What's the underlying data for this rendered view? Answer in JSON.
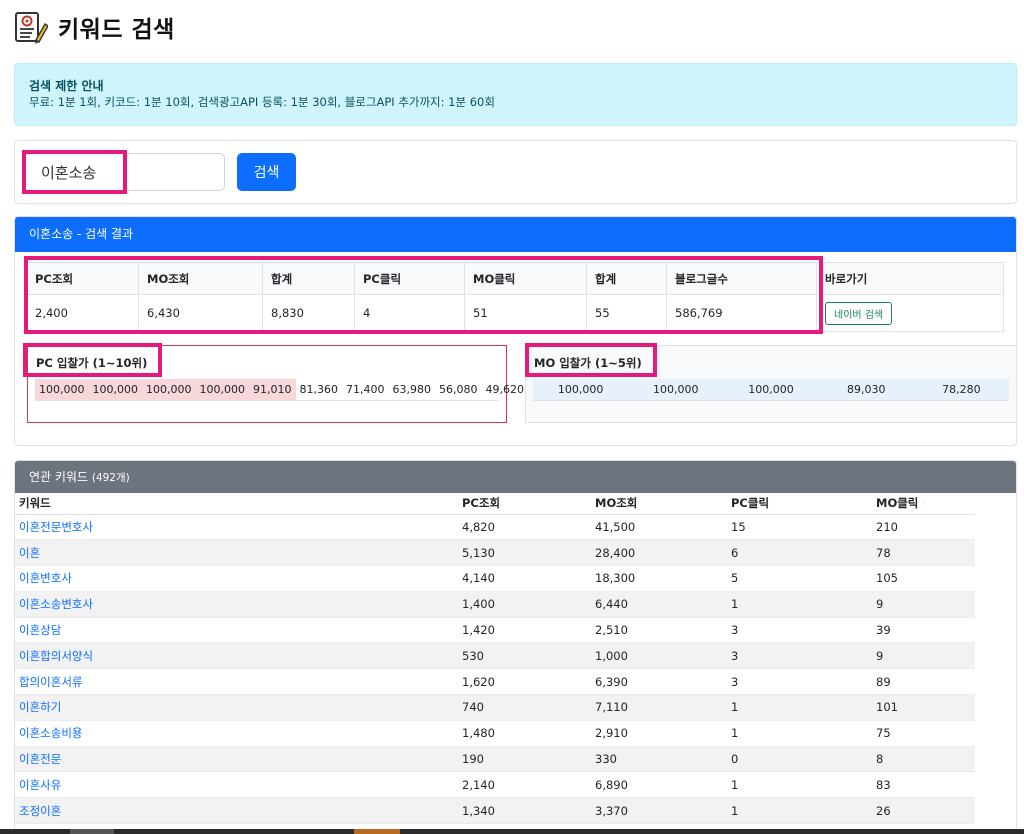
{
  "page": {
    "title": "키워드 검색",
    "icon": "memo-pencil-icon"
  },
  "notice": {
    "title": "검색 제한 안내",
    "text": "무료: 1분 1회, 키코드: 1분 10회, 검색광고API 등록: 1분 30회, 블로그API 추가까지: 1분 60회"
  },
  "search": {
    "value": "이혼소송",
    "button_label": "검색"
  },
  "result": {
    "header": "이혼소송 - 검색 결과",
    "columns": [
      "PC조회",
      "MO조회",
      "합계",
      "PC클릭",
      "MO클릭",
      "합계",
      "블로그글수",
      "바로가기"
    ],
    "values": [
      "2,400",
      "6,430",
      "8,830",
      "4",
      "51",
      "55",
      "586,769"
    ],
    "naver_button": "네이버 검색"
  },
  "pc_bid": {
    "title": "PC 입찰가 (1~10위)",
    "values": [
      "100,000",
      "100,000",
      "100,000",
      "100,000",
      "91,010",
      "81,360",
      "71,400",
      "63,980",
      "56,080",
      "49,620"
    ]
  },
  "mo_bid": {
    "title": "MO 입찰가 (1~5위)",
    "values": [
      "100,000",
      "100,000",
      "100,000",
      "89,030",
      "78,280"
    ]
  },
  "keywords": {
    "header": "연관 키워드",
    "count": "(492개)",
    "columns": [
      "키워드",
      "PC조회",
      "MO조회",
      "PC클릭",
      "MO클릭"
    ],
    "rows": [
      [
        "이혼전문변호사",
        "4,820",
        "41,500",
        "15",
        "210"
      ],
      [
        "이혼",
        "5,130",
        "28,400",
        "6",
        "78"
      ],
      [
        "이혼변호사",
        "4,140",
        "18,300",
        "5",
        "105"
      ],
      [
        "이혼소송변호사",
        "1,400",
        "6,440",
        "1",
        "9"
      ],
      [
        "이혼상담",
        "1,420",
        "2,510",
        "3",
        "39"
      ],
      [
        "이혼합의서양식",
        "530",
        "1,000",
        "3",
        "9"
      ],
      [
        "합의이혼서류",
        "1,620",
        "6,390",
        "3",
        "89"
      ],
      [
        "이혼하기",
        "740",
        "7,110",
        "1",
        "101"
      ],
      [
        "이혼소송비용",
        "1,480",
        "2,910",
        "1",
        "75"
      ],
      [
        "이혼전문",
        "190",
        "330",
        "0",
        "8"
      ],
      [
        "이혼사유",
        "2,140",
        "6,890",
        "1",
        "83"
      ],
      [
        "조정이혼",
        "1,340",
        "3,370",
        "1",
        "26"
      ]
    ]
  },
  "colors": {
    "primary": "#0d6efd",
    "info_bg": "#cff4fc",
    "highlight": "#e6197c",
    "danger": "#dc3545",
    "secondary": "#6c757d",
    "success": "#198754"
  }
}
